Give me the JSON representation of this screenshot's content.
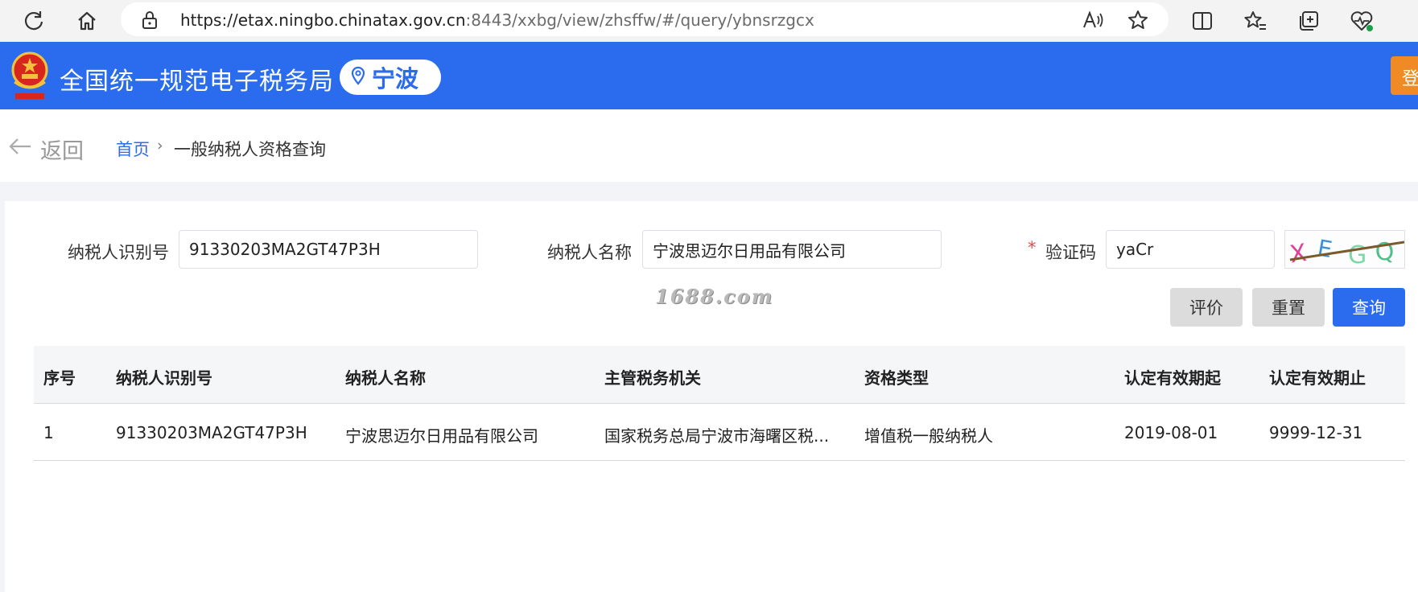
{
  "browser": {
    "url_host": "https://etax.ningbo.chinatax.gov.cn",
    "url_rest": ":8443/xxbg/view/zhsffw/#/query/ybnsrzgcx"
  },
  "header": {
    "site_title": "全国统一规范电子税务局",
    "city": "宁波",
    "login_label": "登录",
    "brand_color": "#2a6ced"
  },
  "breadcrumb": {
    "back_label": "返回",
    "home": "首页",
    "separator": "›",
    "current": "一般纳税人资格查询"
  },
  "form": {
    "taxpayer_id_label": "纳税人识别号",
    "taxpayer_id_value": "91330203MA2GT47P3H",
    "taxpayer_name_label": "纳税人名称",
    "taxpayer_name_value": "宁波思迈尔日用品有限公司",
    "captcha_required": "*",
    "captcha_label": "验证码",
    "captcha_value": "yaCr",
    "captcha_image_text": "XEGQ"
  },
  "watermark": "1688.com",
  "actions": {
    "rate": "评价",
    "reset": "重置",
    "query": "查询"
  },
  "table": {
    "columns": [
      "序号",
      "纳税人识别号",
      "纳税人名称",
      "主管税务机关",
      "资格类型",
      "认定有效期起",
      "认定有效期止"
    ],
    "rows": [
      [
        "1",
        "91330203MA2GT47P3H",
        "宁波思迈尔日用品有限公司",
        "国家税务总局宁波市海曙区税...",
        "增值税一般纳税人",
        "2019-08-01",
        "9999-12-31"
      ]
    ]
  }
}
